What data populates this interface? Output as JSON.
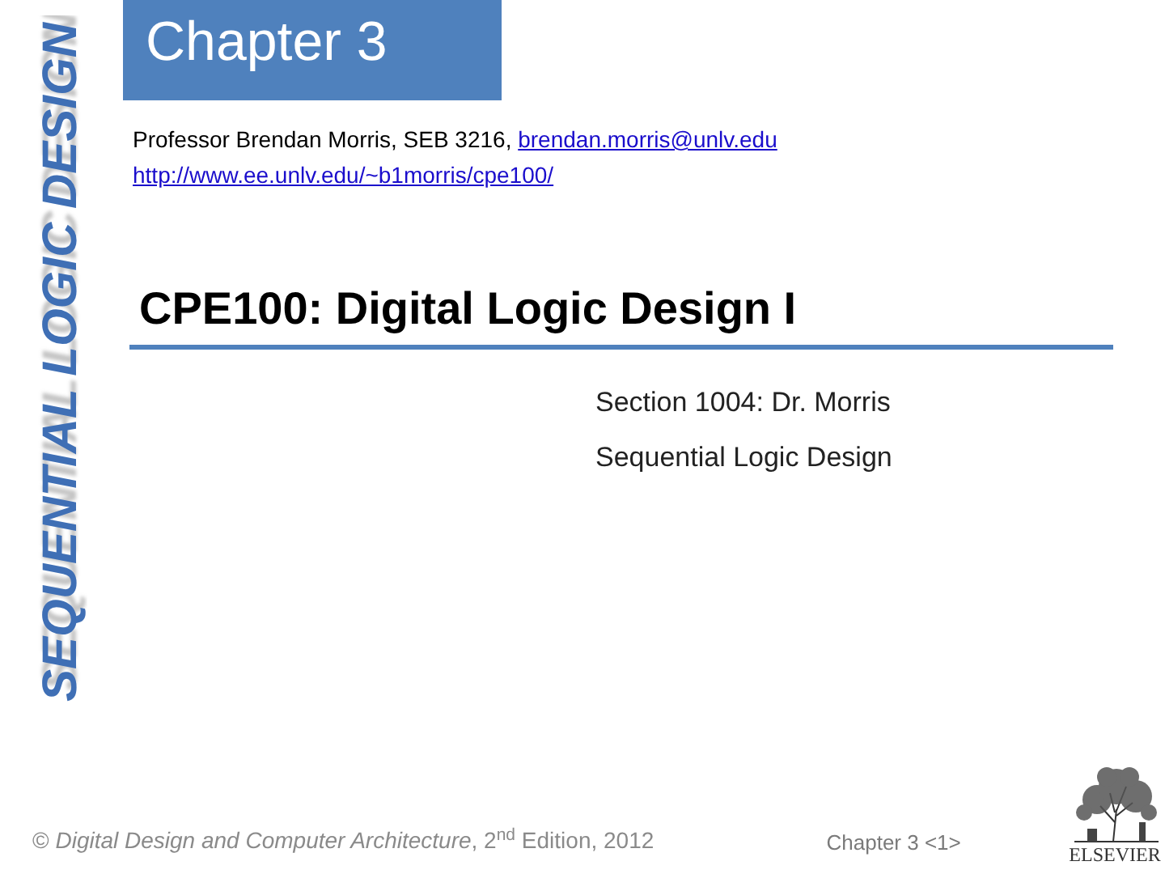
{
  "side_banner": "SEQUENTIAL LOGIC DESIGN",
  "header": {
    "title": "Chapter 3"
  },
  "contact": {
    "text": "Professor Brendan Morris, SEB 3216, ",
    "email": "brendan.morris@unlv.edu",
    "url": "http://www.ee.unlv.edu/~b1morris/cpe100/"
  },
  "title": "CPE100: Digital Logic Design I",
  "subtitle_lines": [
    "Section 1004: Dr. Morris",
    "Sequential Logic Design"
  ],
  "footer": {
    "copyright": "© *Digital Design and Computer Architecture*, 2$^{nd}$ Edition, 2012",
    "page": "Chapter 3 <1>",
    "publisher": "ELSEVIER"
  }
}
